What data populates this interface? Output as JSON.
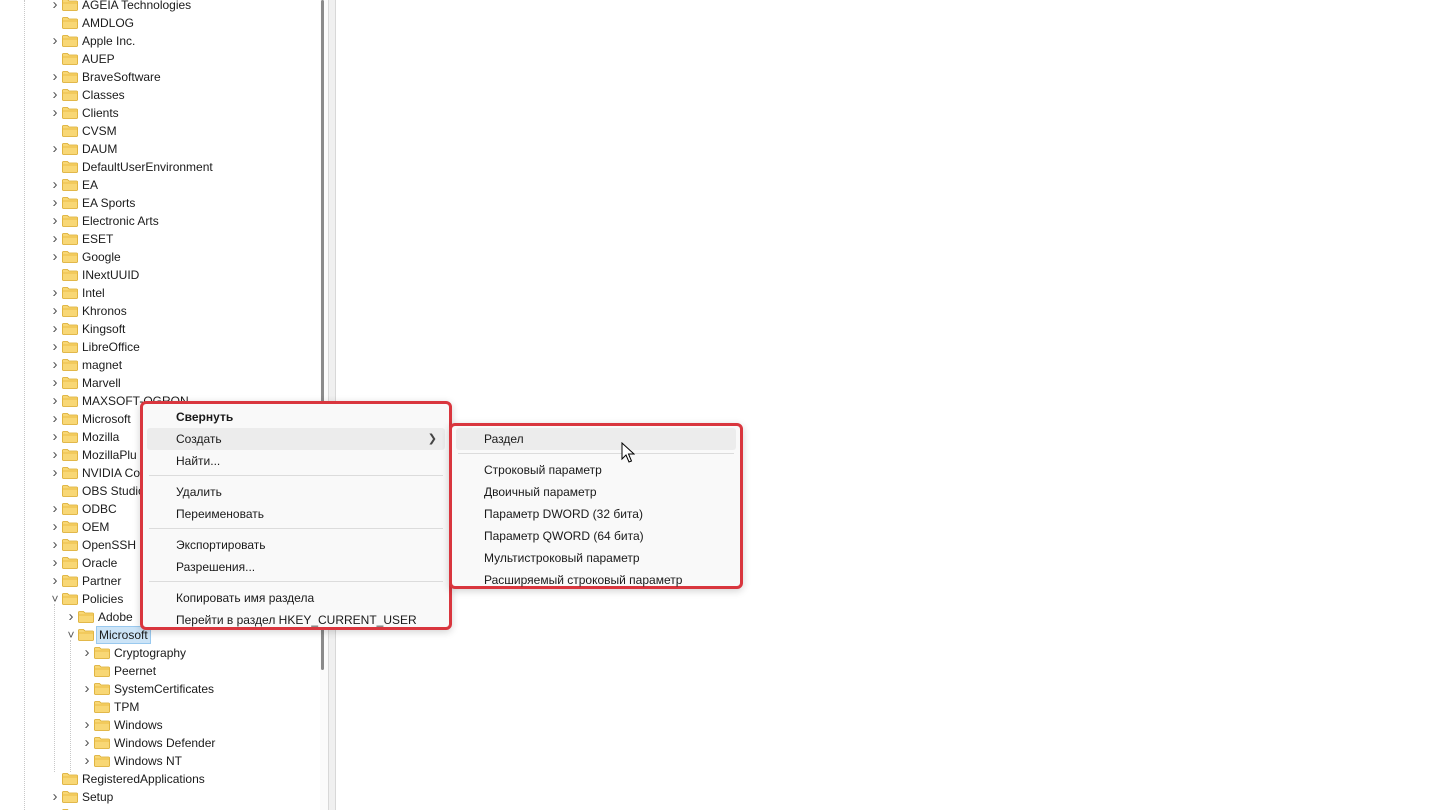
{
  "tree": {
    "items": [
      {
        "label": "AGEIA Technologies",
        "level": 0,
        "expand": "collapsed"
      },
      {
        "label": "AMDLOG",
        "level": 0,
        "expand": "none"
      },
      {
        "label": "Apple Inc.",
        "level": 0,
        "expand": "collapsed"
      },
      {
        "label": "AUEP",
        "level": 0,
        "expand": "none"
      },
      {
        "label": "BraveSoftware",
        "level": 0,
        "expand": "collapsed"
      },
      {
        "label": "Classes",
        "level": 0,
        "expand": "collapsed"
      },
      {
        "label": "Clients",
        "level": 0,
        "expand": "collapsed"
      },
      {
        "label": "CVSM",
        "level": 0,
        "expand": "none"
      },
      {
        "label": "DAUM",
        "level": 0,
        "expand": "collapsed"
      },
      {
        "label": "DefaultUserEnvironment",
        "level": 0,
        "expand": "none"
      },
      {
        "label": "EA",
        "level": 0,
        "expand": "collapsed"
      },
      {
        "label": "EA Sports",
        "level": 0,
        "expand": "collapsed"
      },
      {
        "label": "Electronic Arts",
        "level": 0,
        "expand": "collapsed"
      },
      {
        "label": "ESET",
        "level": 0,
        "expand": "collapsed"
      },
      {
        "label": "Google",
        "level": 0,
        "expand": "collapsed"
      },
      {
        "label": "INextUUID",
        "level": 0,
        "expand": "none"
      },
      {
        "label": "Intel",
        "level": 0,
        "expand": "collapsed"
      },
      {
        "label": "Khronos",
        "level": 0,
        "expand": "collapsed"
      },
      {
        "label": "Kingsoft",
        "level": 0,
        "expand": "collapsed"
      },
      {
        "label": "LibreOffice",
        "level": 0,
        "expand": "collapsed"
      },
      {
        "label": "magnet",
        "level": 0,
        "expand": "collapsed"
      },
      {
        "label": "Marvell",
        "level": 0,
        "expand": "collapsed"
      },
      {
        "label": "MAXSOFT-OGRON",
        "level": 0,
        "expand": "collapsed"
      },
      {
        "label": "Microsoft",
        "level": 0,
        "expand": "collapsed"
      },
      {
        "label": "Mozilla",
        "level": 0,
        "expand": "collapsed"
      },
      {
        "label": "MozillaPlu",
        "level": 0,
        "expand": "collapsed"
      },
      {
        "label": "NVIDIA Co",
        "level": 0,
        "expand": "collapsed"
      },
      {
        "label": "OBS Studio",
        "level": 0,
        "expand": "none"
      },
      {
        "label": "ODBC",
        "level": 0,
        "expand": "collapsed"
      },
      {
        "label": "OEM",
        "level": 0,
        "expand": "collapsed"
      },
      {
        "label": "OpenSSH",
        "level": 0,
        "expand": "collapsed"
      },
      {
        "label": "Oracle",
        "level": 0,
        "expand": "collapsed"
      },
      {
        "label": "Partner",
        "level": 0,
        "expand": "collapsed"
      },
      {
        "label": "Policies",
        "level": 0,
        "expand": "expanded"
      },
      {
        "label": "Adobe",
        "level": 1,
        "expand": "collapsed"
      },
      {
        "label": "Microsoft",
        "level": 1,
        "expand": "expanded",
        "selected": true
      },
      {
        "label": "Cryptography",
        "level": 2,
        "expand": "collapsed"
      },
      {
        "label": "Peernet",
        "level": 2,
        "expand": "none"
      },
      {
        "label": "SystemCertificates",
        "level": 2,
        "expand": "collapsed"
      },
      {
        "label": "TPM",
        "level": 2,
        "expand": "none"
      },
      {
        "label": "Windows",
        "level": 2,
        "expand": "collapsed"
      },
      {
        "label": "Windows Defender",
        "level": 2,
        "expand": "collapsed"
      },
      {
        "label": "Windows NT",
        "level": 2,
        "expand": "collapsed"
      },
      {
        "label": "RegisteredApplications",
        "level": 0,
        "expand": "none"
      },
      {
        "label": "Setup",
        "level": 0,
        "expand": "collapsed"
      },
      {
        "label": "",
        "level": 0,
        "expand": "collapsed"
      }
    ]
  },
  "context_menu": {
    "collapse": "Свернуть",
    "create": "Создать",
    "find": "Найти...",
    "delete": "Удалить",
    "rename": "Переименовать",
    "export": "Экспортировать",
    "permissions": "Разрешения...",
    "copy_key_name": "Копировать имя раздела",
    "go_to_hkcu": "Перейти в раздел HKEY_CURRENT_USER"
  },
  "submenu": {
    "key": "Раздел",
    "string_value": "Строковый параметр",
    "binary_value": "Двоичный параметр",
    "dword_value": "Параметр DWORD (32 бита)",
    "qword_value": "Параметр QWORD (64 бита)",
    "multi_string_value": "Мультистроковый параметр",
    "expandable_string_value": "Расширяемый строковый параметр"
  },
  "colors": {
    "highlight_border": "#d9363e",
    "selection_bg": "#cce4f7",
    "folder_yellow": "#f5c542"
  },
  "icons": {
    "folder": "folder-icon",
    "chevron_right": "chevron-right-icon",
    "chevron_down": "chevron-down-icon",
    "submenu_arrow": "chevron-right-icon",
    "cursor": "mouse-pointer-icon"
  }
}
